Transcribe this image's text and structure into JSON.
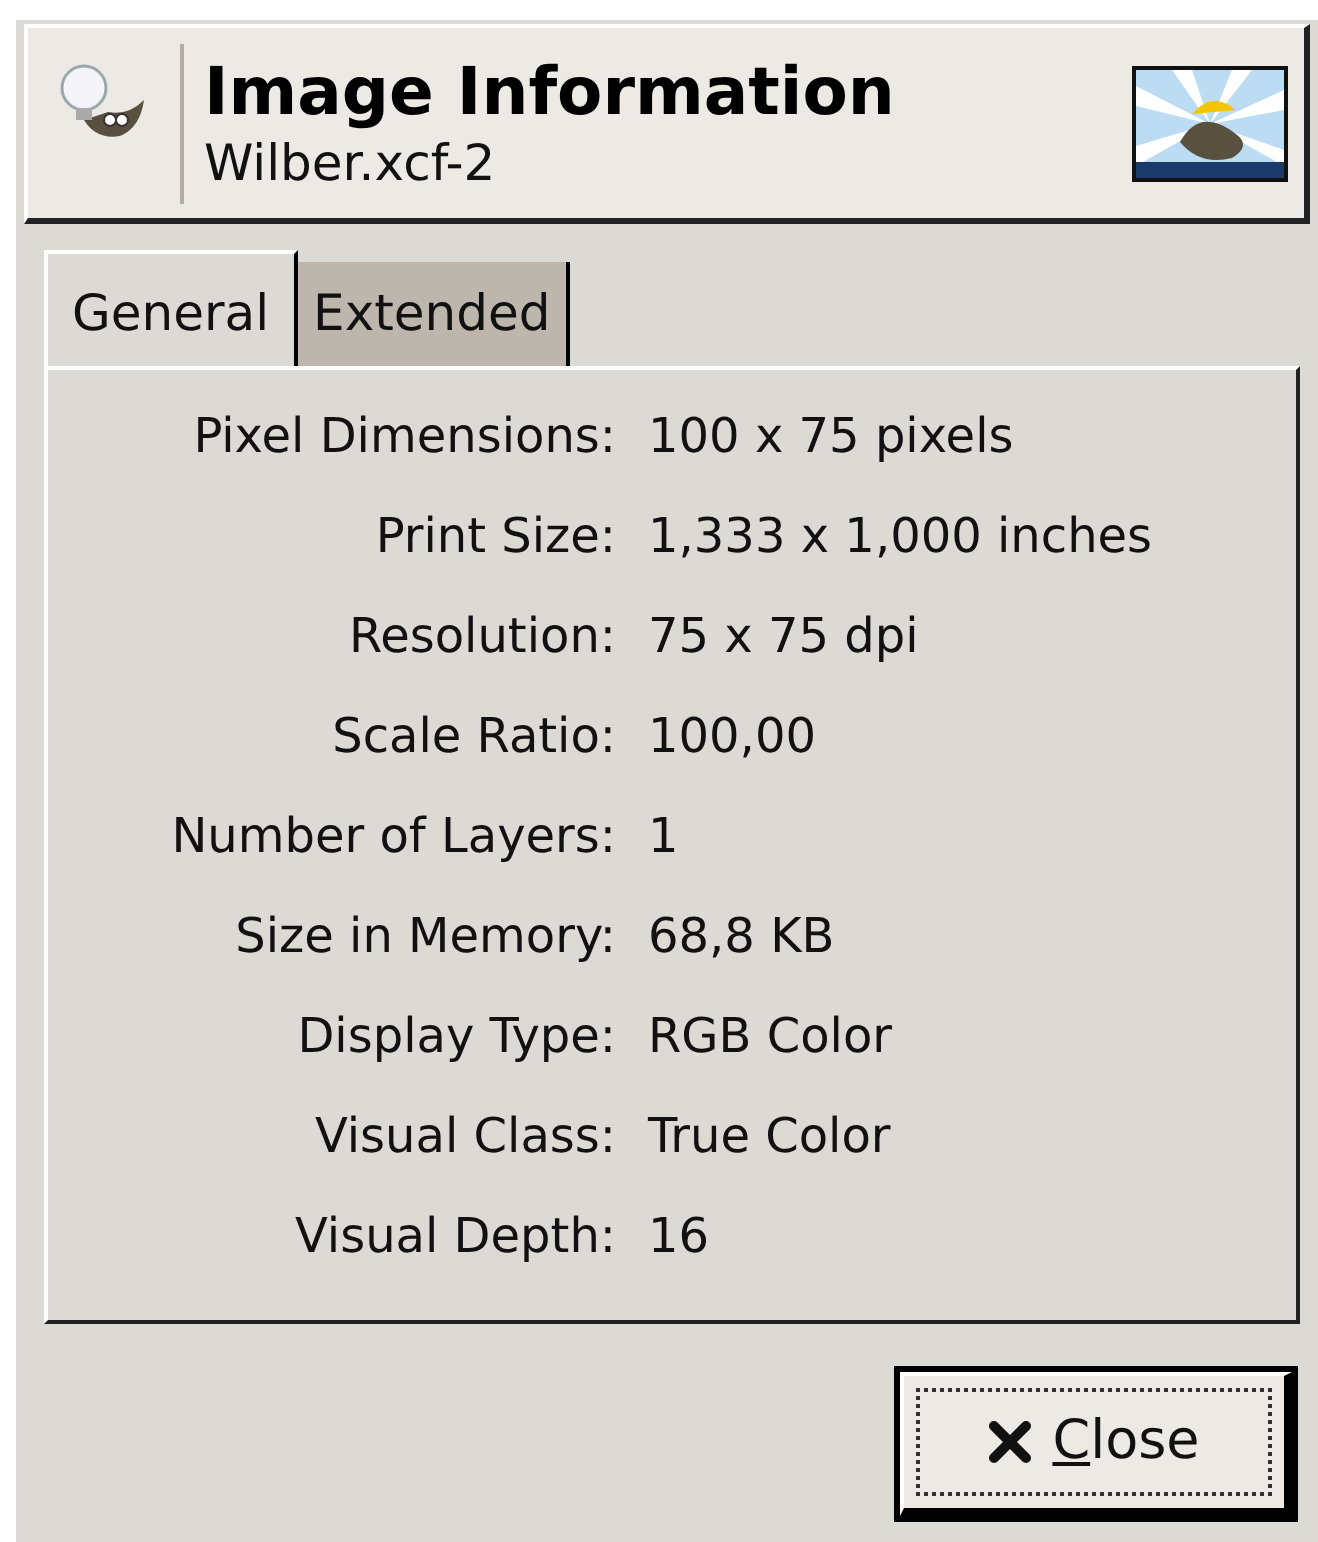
{
  "header": {
    "title": "Image Information",
    "subtitle": "Wilber.xcf-2"
  },
  "tabs": [
    {
      "label": "General",
      "selected": true
    },
    {
      "label": "Extended",
      "selected": false
    }
  ],
  "rows": [
    {
      "label": "Pixel Dimensions:",
      "value": "100 x 75 pixels"
    },
    {
      "label": "Print Size:",
      "value": "1,333 x 1,000 inches"
    },
    {
      "label": "Resolution:",
      "value": "75 x 75 dpi"
    },
    {
      "label": "Scale Ratio:",
      "value": "100,00"
    },
    {
      "label": "Number of Layers:",
      "value": "1"
    },
    {
      "label": "Size in Memory:",
      "value": "68,8 KB"
    },
    {
      "label": "Display Type:",
      "value": "RGB Color"
    },
    {
      "label": "Visual Class:",
      "value": "True Color"
    },
    {
      "label": "Visual Depth:",
      "value": "16"
    }
  ],
  "close_button": {
    "mnemonic": "C",
    "rest": "lose"
  }
}
